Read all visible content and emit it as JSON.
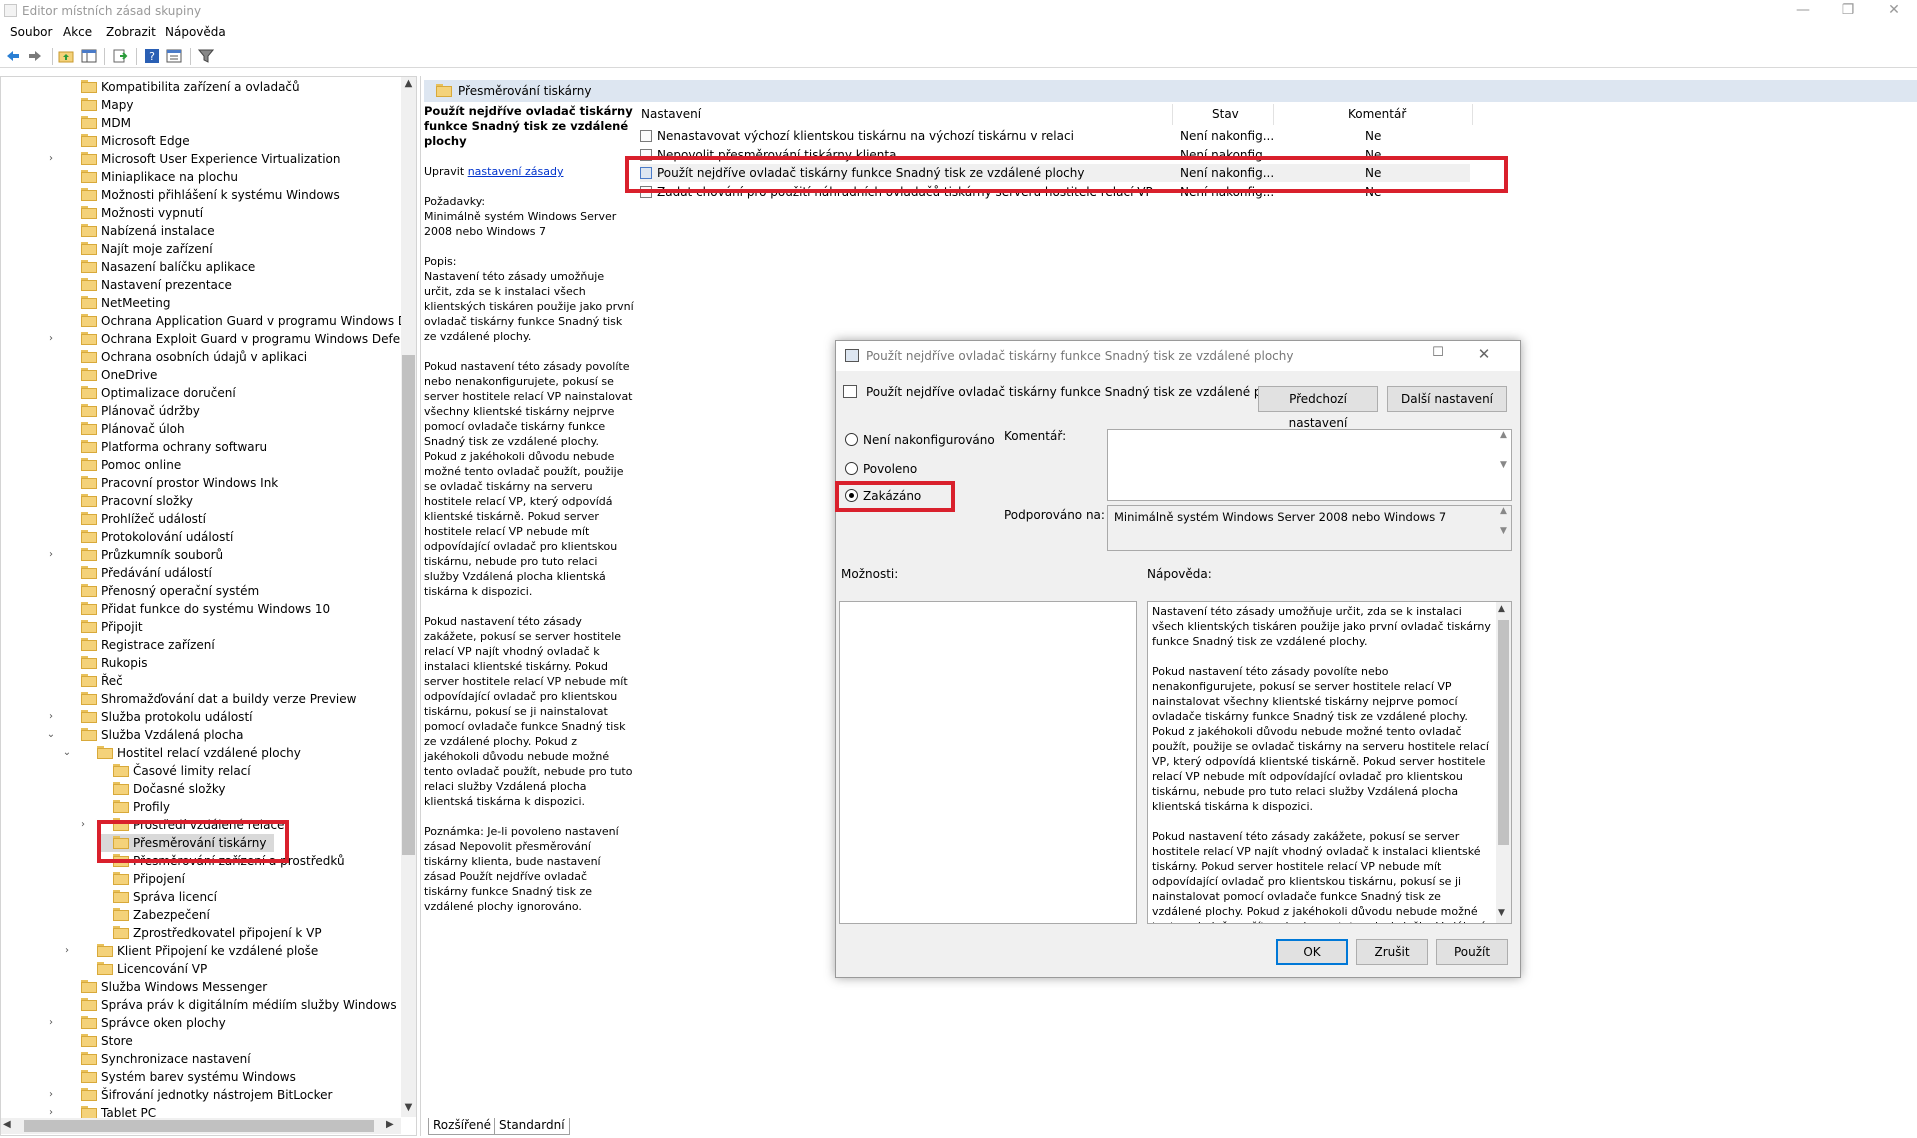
{
  "window": {
    "title": "Editor místních zásad skupiny",
    "min": "—",
    "restore": "❐",
    "close": "✕"
  },
  "menu": [
    "Soubor",
    "Akce",
    "Zobrazit",
    "Nápověda"
  ],
  "toolbar": {
    "icons": [
      "back-icon",
      "forward-icon",
      "up-folder-icon",
      "show-hide-tree-icon",
      "export-list-icon",
      "help-icon",
      "properties-icon",
      "filter-icon"
    ]
  },
  "tree": {
    "items": [
      {
        "label": "Kompatibilita zařízení a ovladačů",
        "level": 0,
        "arrow": ""
      },
      {
        "label": "Mapy",
        "level": 0,
        "arrow": ""
      },
      {
        "label": "MDM",
        "level": 0,
        "arrow": ""
      },
      {
        "label": "Microsoft Edge",
        "level": 0,
        "arrow": ""
      },
      {
        "label": "Microsoft User Experience Virtualization",
        "level": 0,
        "arrow": "›"
      },
      {
        "label": "Miniaplikace na plochu",
        "level": 0,
        "arrow": ""
      },
      {
        "label": "Možnosti přihlášení k systému Windows",
        "level": 0,
        "arrow": ""
      },
      {
        "label": "Možnosti vypnutí",
        "level": 0,
        "arrow": ""
      },
      {
        "label": "Nabízená instalace",
        "level": 0,
        "arrow": ""
      },
      {
        "label": "Najít moje zařízení",
        "level": 0,
        "arrow": ""
      },
      {
        "label": "Nasazení balíčku aplikace",
        "level": 0,
        "arrow": ""
      },
      {
        "label": "Nastavení prezentace",
        "level": 0,
        "arrow": ""
      },
      {
        "label": "NetMeeting",
        "level": 0,
        "arrow": ""
      },
      {
        "label": "Ochrana Application Guard v programu Windows Defender",
        "level": 0,
        "arrow": ""
      },
      {
        "label": "Ochrana Exploit Guard v programu Windows Defender",
        "level": 0,
        "arrow": "›"
      },
      {
        "label": "Ochrana osobních údajů v aplikaci",
        "level": 0,
        "arrow": ""
      },
      {
        "label": "OneDrive",
        "level": 0,
        "arrow": ""
      },
      {
        "label": "Optimalizace doručení",
        "level": 0,
        "arrow": ""
      },
      {
        "label": "Plánovač údržby",
        "level": 0,
        "arrow": ""
      },
      {
        "label": "Plánovač úloh",
        "level": 0,
        "arrow": ""
      },
      {
        "label": "Platforma ochrany softwaru",
        "level": 0,
        "arrow": ""
      },
      {
        "label": "Pomoc online",
        "level": 0,
        "arrow": ""
      },
      {
        "label": "Pracovní prostor Windows Ink",
        "level": 0,
        "arrow": ""
      },
      {
        "label": "Pracovní složky",
        "level": 0,
        "arrow": ""
      },
      {
        "label": "Prohlížeč událostí",
        "level": 0,
        "arrow": ""
      },
      {
        "label": "Protokolování událostí",
        "level": 0,
        "arrow": ""
      },
      {
        "label": "Průzkumník souborů",
        "level": 0,
        "arrow": "›"
      },
      {
        "label": "Předávání událostí",
        "level": 0,
        "arrow": ""
      },
      {
        "label": "Přenosný operační systém",
        "level": 0,
        "arrow": ""
      },
      {
        "label": "Přidat funkce do systému Windows 10",
        "level": 0,
        "arrow": ""
      },
      {
        "label": "Připojit",
        "level": 0,
        "arrow": ""
      },
      {
        "label": "Registrace zařízení",
        "level": 0,
        "arrow": ""
      },
      {
        "label": "Rukopis",
        "level": 0,
        "arrow": ""
      },
      {
        "label": "Řeč",
        "level": 0,
        "arrow": ""
      },
      {
        "label": "Shromažďování dat a buildy verze Preview",
        "level": 0,
        "arrow": ""
      },
      {
        "label": "Služba protokolu událostí",
        "level": 0,
        "arrow": "›"
      },
      {
        "label": "Služba Vzdálená plocha",
        "level": 0,
        "arrow": "⌄"
      },
      {
        "label": "Hostitel relací vzdálené plochy",
        "level": 1,
        "arrow": "⌄"
      },
      {
        "label": "Časové limity relací",
        "level": 2,
        "arrow": ""
      },
      {
        "label": "Dočasné složky",
        "level": 2,
        "arrow": ""
      },
      {
        "label": "Profily",
        "level": 2,
        "arrow": ""
      },
      {
        "label": "Prostředí vzdálené relace",
        "level": 2,
        "arrow": "›"
      },
      {
        "label": "Přesměrování tiskárny",
        "level": 2,
        "arrow": ""
      },
      {
        "label": "Přesměrování zařízení a prostředků",
        "level": 2,
        "arrow": ""
      },
      {
        "label": "Připojení",
        "level": 2,
        "arrow": ""
      },
      {
        "label": "Správa licencí",
        "level": 2,
        "arrow": ""
      },
      {
        "label": "Zabezpečení",
        "level": 2,
        "arrow": ""
      },
      {
        "label": "Zprostředkovatel připojení k VP",
        "level": 2,
        "arrow": ""
      },
      {
        "label": "Klient Připojení ke vzdálené ploše",
        "level": 1,
        "arrow": "›"
      },
      {
        "label": "Licencování VP",
        "level": 1,
        "arrow": ""
      },
      {
        "label": "Služba Windows Messenger",
        "level": 0,
        "arrow": ""
      },
      {
        "label": "Správa práv k digitálním médiím služby Windows Media",
        "level": 0,
        "arrow": ""
      },
      {
        "label": "Správce oken plochy",
        "level": 0,
        "arrow": "›"
      },
      {
        "label": "Store",
        "level": 0,
        "arrow": ""
      },
      {
        "label": "Synchronizace nastavení",
        "level": 0,
        "arrow": ""
      },
      {
        "label": "Systém barev systému Windows",
        "level": 0,
        "arrow": ""
      },
      {
        "label": "Šifrování jednotky nástrojem BitLocker",
        "level": 0,
        "arrow": "›"
      },
      {
        "label": "Tablet PC",
        "level": 0,
        "arrow": "›"
      }
    ],
    "selected_index": 42
  },
  "right": {
    "header": "Přesměrování tiskárny",
    "ext": {
      "title": "Použít nejdříve ovladač tiskárny funkce Snadný tisk ze vzdálené plochy",
      "edit_prefix": "Upravit",
      "edit_link": "nastavení zásady",
      "req_label": "Požadavky:",
      "req_text": "Minimálně systém Windows Server 2008 nebo Windows 7",
      "desc_label": "Popis:",
      "desc_1": "Nastavení této zásady umožňuje určit, zda se k instalaci všech klientských tiskáren použije jako první ovladač tiskárny funkce Snadný tisk ze vzdálené plochy.",
      "desc_2": "Pokud nastavení této zásady povolíte nebo nenakonfigurujete, pokusí se server hostitele relací VP nainstalovat všechny klientské tiskárny nejprve pomocí ovladače tiskárny funkce Snadný tisk ze vzdálené plochy. Pokud z jakéhokoli důvodu nebude možné tento ovladač použít, použije se ovladač tiskárny na serveru hostitele relací VP, který odpovídá klientské tiskárně. Pokud server hostitele relací VP nebude mít odpovídající ovladač pro klientskou tiskárnu, nebude pro tuto relaci služby Vzdálená plocha klientská tiskárna k dispozici.",
      "desc_3": "Pokud nastavení této zásady zakážete, pokusí se server hostitele relací VP najít vhodný ovladač k instalaci klientské tiskárny. Pokud server hostitele relací VP nebude mít odpovídající ovladač pro klientskou tiskárnu, pokusí se ji nainstalovat pomocí ovladače funkce Snadný tisk ze vzdálené plochy. Pokud z jakéhokoli důvodu nebude možné tento ovladač použít, nebude pro tuto relaci služby Vzdálená plocha klientská tiskárna k dispozici.",
      "note": "Poznámka: Je-li povoleno nastavení zásad Nepovolit přesměrování tiskárny klienta, bude nastavení zásad Použít nejdříve ovladač tiskárny funkce Snadný tisk ze vzdálené plochy ignorováno."
    },
    "columns": {
      "name": "Nastavení",
      "state": "Stav",
      "comment": "Komentář"
    },
    "rows": [
      {
        "name": "Nenastavovat výchozí klientskou tiskárnu na výchozí tiskárnu v relaci",
        "state": "Není nakonfig...",
        "comment": "Ne"
      },
      {
        "name": "Nepovolit přesměrování tiskárny klienta",
        "state": "Není nakonfig...",
        "comment": "Ne"
      },
      {
        "name": "Použít nejdříve ovladač tiskárny funkce Snadný tisk ze vzdálené plochy",
        "state": "Není nakonfig...",
        "comment": "Ne"
      },
      {
        "name": "Zadat chování pro použití náhradních ovladačů tiskárny serveru hostitele relací VP",
        "state": "Není nakonfig...",
        "comment": "Ne"
      }
    ],
    "tabs": [
      "Rozšířené",
      "Standardní"
    ]
  },
  "dialog": {
    "title": "Použít nejdříve ovladač tiskárny funkce Snadný tisk ze vzdálené plochy",
    "setting_name": "Použít nejdříve ovladač tiskárny funkce Snadný tisk ze vzdálené plochy",
    "prev_btn": "Předchozí nastavení",
    "next_btn": "Další nastavení",
    "radio_not_configured": "Není nakonfigurováno",
    "radio_enabled": "Povoleno",
    "radio_disabled": "Zakázáno",
    "selected": "Zakázáno",
    "comment_label": "Komentář:",
    "comment_value": "",
    "supported_label": "Podporováno na:",
    "supported_value": "Minimálně systém Windows Server 2008 nebo Windows 7",
    "options_label": "Možnosti:",
    "help_label": "Nápověda:",
    "help_1": "Nastavení této zásady umožňuje určit, zda se k instalaci všech klientských tiskáren použije jako první ovladač tiskárny funkce Snadný tisk ze vzdálené plochy.",
    "help_2": "Pokud nastavení této zásady povolíte nebo nenakonfigurujete, pokusí se server hostitele relací VP nainstalovat všechny klientské tiskárny nejprve pomocí ovladače tiskárny funkce Snadný tisk ze vzdálené plochy. Pokud z jakéhokoli důvodu nebude možné tento ovladač použít, použije se ovladač tiskárny na serveru hostitele relací VP, který odpovídá klientské tiskárně. Pokud server hostitele relací VP nebude mít odpovídající ovladač pro klientskou tiskárnu, nebude pro tuto relaci služby Vzdálená plocha klientská tiskárna k dispozici.",
    "help_3": "Pokud nastavení této zásady zakážete, pokusí se server hostitele relací VP najít vhodný ovladač k instalaci klientské tiskárny. Pokud server hostitele relací VP nebude mít odpovídající ovladač pro klientskou tiskárnu, pokusí se ji nainstalovat pomocí ovladače funkce Snadný tisk ze vzdálené plochy. Pokud z jakéhokoli důvodu nebude možné tento ovladač použít, nebude pro tuto relaci služby Vzdálená plocha klientská tiskárna k dispozici.",
    "ok": "OK",
    "cancel": "Zrušit",
    "apply": "Použít"
  },
  "colors": {
    "highlight": "#d9202c",
    "header_bg": "#dde6f1",
    "accent": "#0078d7"
  }
}
